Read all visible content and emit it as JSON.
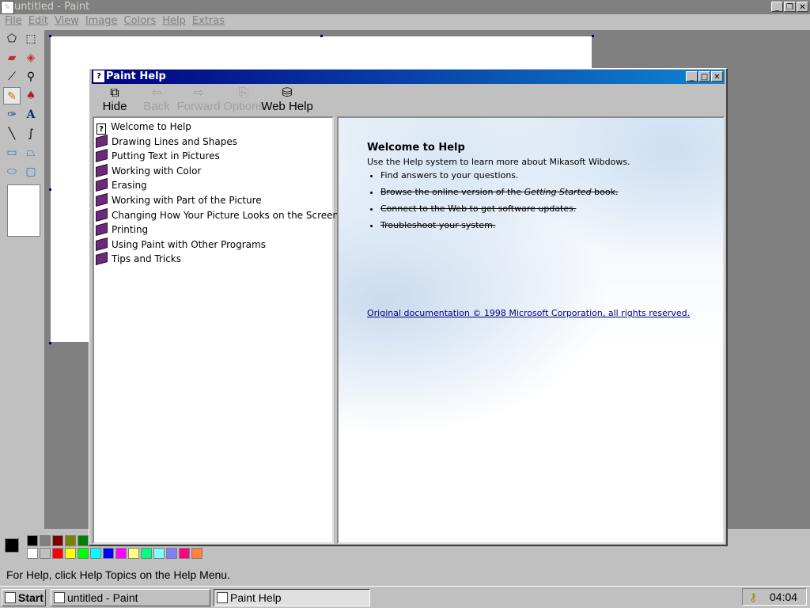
{
  "paint": {
    "title": "untitled - Paint",
    "menu": [
      "File",
      "Edit",
      "View",
      "Image",
      "Colors",
      "Help",
      "Extras"
    ],
    "status": "For Help, click Help Topics on the Help Menu."
  },
  "help": {
    "title": "Paint Help",
    "toolbar": [
      {
        "label": "Hide",
        "icon": "hide-icon",
        "enabled": true
      },
      {
        "label": "Back",
        "icon": "back-arrow-icon",
        "enabled": false
      },
      {
        "label": "Forward",
        "icon": "forward-arrow-icon",
        "enabled": false
      },
      {
        "label": "Options",
        "icon": "options-icon",
        "enabled": false
      },
      {
        "label": "Web Help",
        "icon": "web-help-icon",
        "enabled": true
      }
    ],
    "toc": [
      {
        "label": "Welcome to Help",
        "icon": "help-page-icon"
      },
      {
        "label": "Drawing Lines and Shapes",
        "icon": "book-icon"
      },
      {
        "label": "Putting Text in Pictures",
        "icon": "book-icon"
      },
      {
        "label": "Working with Color",
        "icon": "book-icon"
      },
      {
        "label": "Erasing",
        "icon": "book-icon"
      },
      {
        "label": "Working with Part of the Picture",
        "icon": "book-icon"
      },
      {
        "label": "Changing How Your Picture Looks on the Screen",
        "icon": "book-icon"
      },
      {
        "label": "Printing",
        "icon": "book-icon"
      },
      {
        "label": "Using Paint with Other Programs",
        "icon": "book-icon"
      },
      {
        "label": "Tips and Tricks",
        "icon": "book-icon"
      }
    ],
    "content": {
      "heading": "Welcome to Help",
      "intro": "Use the Help system to learn more about Mikasoft Wibdows.",
      "bullets": {
        "b1": "Find answers to your questions.",
        "b2_pre": "Browse the online version of the ",
        "b2_em": "Getting Started",
        "b2_post": " book.",
        "b3": "Connect to the Web to get software updates.",
        "b4": "Troubleshoot your system."
      },
      "copyright": "Original documentation © 1998 Microsoft Corporation, all rights reserved."
    }
  },
  "taskbar": {
    "start": "Start",
    "tasks": [
      "untitled - Paint",
      "Paint Help"
    ],
    "clock": "04:04"
  },
  "palette": {
    "foreground": "#000000",
    "background": "#ffffff",
    "row1": [
      "#000000",
      "#808080",
      "#800000",
      "#808000",
      "#008000"
    ],
    "row2": [
      "#ffffff",
      "#c0c0c0",
      "#ff0000",
      "#ffff00",
      "#00ff00",
      "#00ffff",
      "#0000ff",
      "#ff00ff",
      "#ffff80",
      "#00ff80",
      "#80ffff",
      "#8080ff",
      "#ff0080",
      "#ff8040"
    ]
  }
}
